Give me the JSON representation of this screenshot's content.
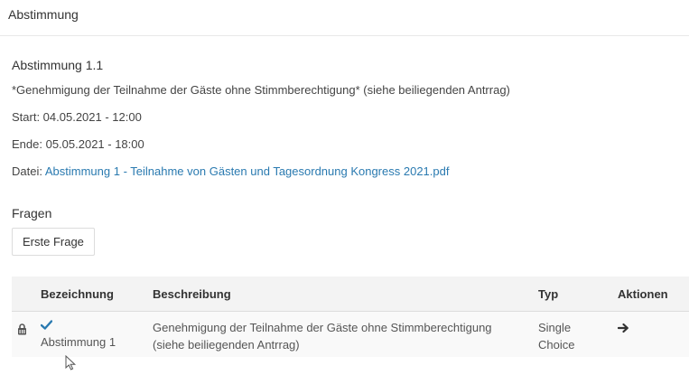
{
  "header": {
    "title": "Abstimmung"
  },
  "poll": {
    "title": "Abstimmung 1.1",
    "subtitle": "*Genehmigung der Teilnahme der Gäste ohne Stimmberechtigung* (siehe beiliegenden Antrrag)",
    "start": "Start: 04.05.2021 - 12:00",
    "end": "Ende: 05.05.2021 - 18:00",
    "file_label": "Datei:",
    "file_name": "Abstimmung 1 - Teilnahme von Gästen und Tagesordnung Kongress 2021.pdf"
  },
  "questions": {
    "title": "Fragen",
    "tab_label": "Erste Frage",
    "columns": [
      "Bezeichnung",
      "Beschreibung",
      "Typ",
      "Aktionen"
    ],
    "rows": [
      {
        "name": "Abstimmung 1",
        "description": "Genehmigung der Teilnahme der Gäste ohne Stimmberechtigung (siehe beiliegenden Antrrag)",
        "type": "Single Choice",
        "checked": true,
        "locked": true
      }
    ]
  },
  "icons": {
    "lock": "lock-icon",
    "check": "check-icon",
    "action": "arrow-right-icon",
    "cursor": "mouse-cursor-icon"
  },
  "colors": {
    "link": "#2a7ab0",
    "check": "#2a7ab0"
  }
}
